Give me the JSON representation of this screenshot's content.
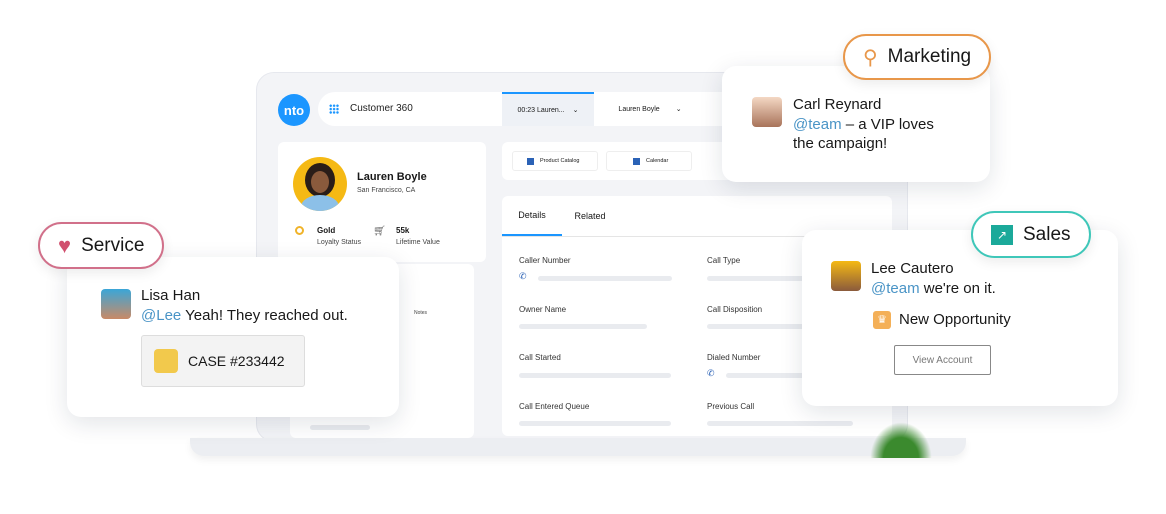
{
  "app": {
    "logo": "nto",
    "title": "Customer 360",
    "call_tab": "00:23 Lauren...",
    "contact_tab": "Lauren Boyle"
  },
  "profile": {
    "name": "Lauren Boyle",
    "location": "San Francisco, CA",
    "loyalty_value": "Gold",
    "loyalty_label": "Loyalty Status",
    "lifetime_value": "55k",
    "lifetime_label": "Lifetime Value"
  },
  "quick_actions": [
    "Product Catalog",
    "Calendar"
  ],
  "tabs": [
    "Details",
    "Related"
  ],
  "fields": {
    "caller_number": "Caller Number",
    "call_type": "Call Type",
    "owner_name": "Owner Name",
    "call_disposition": "Call Disposition",
    "call_started": "Call Started",
    "dialed_number": "Dialed Number",
    "call_entered_queue": "Call Entered Queue",
    "previous_call": "Previous Call"
  },
  "notes_label": "Notes",
  "service": {
    "pill": "Service",
    "color": "#d1708a",
    "name": "Lisa Han",
    "mention": "@Lee",
    "text": " Yeah! They reached out.",
    "case": "CASE #233442"
  },
  "marketing": {
    "pill": "Marketing",
    "color": "#e8974a",
    "name": "Carl Reynard",
    "mention": "@team",
    "text": " – a VIP loves the campaign!"
  },
  "sales": {
    "pill": "Sales",
    "color": "#3fc7b9",
    "name": "Lee Cautero",
    "mention": "@team",
    "text": " we're on it.",
    "opportunity": "New Opportunity",
    "button": "View Account"
  },
  "colors": {
    "accent": "#1b96ff",
    "mention": "#4a94c6"
  }
}
